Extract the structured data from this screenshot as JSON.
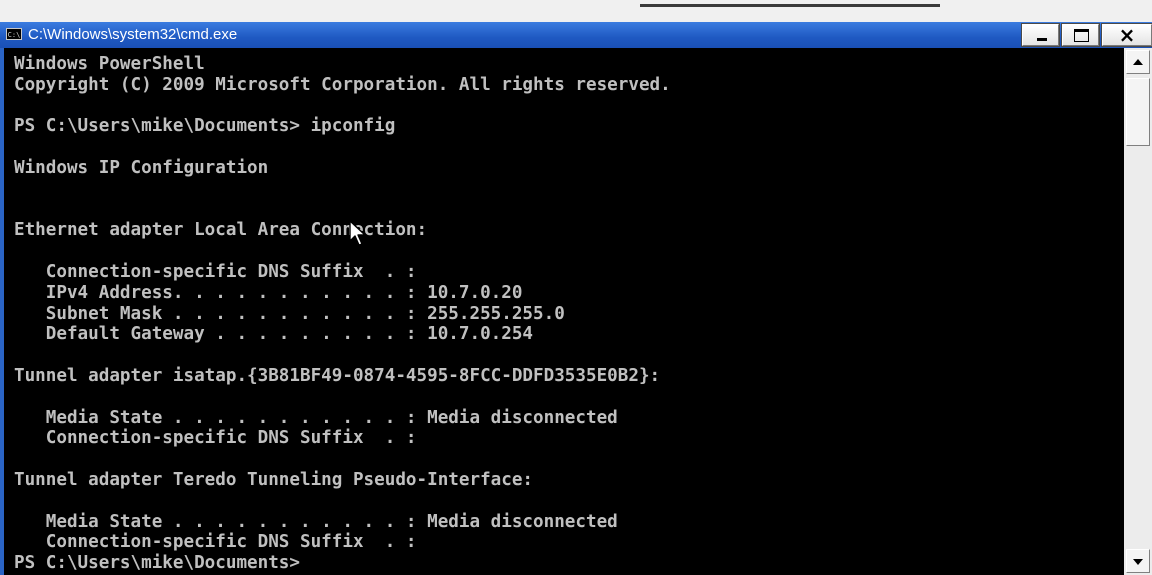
{
  "window": {
    "title": "C:\\Windows\\system32\\cmd.exe",
    "icon_label": "C:\\",
    "icon": "console-icon",
    "buttons": {
      "minimize": "minimize-icon",
      "maximize": "maximize-icon",
      "close_glyph": "×"
    }
  },
  "console": {
    "lines": [
      "Windows PowerShell",
      "Copyright (C) 2009 Microsoft Corporation. All rights reserved.",
      "",
      "PS C:\\Users\\mike\\Documents> ipconfig",
      "",
      "Windows IP Configuration",
      "",
      "",
      "Ethernet adapter Local Area Connection:",
      "",
      "   Connection-specific DNS Suffix  . :",
      "   IPv4 Address. . . . . . . . . . . : 10.7.0.20",
      "   Subnet Mask . . . . . . . . . . . : 255.255.255.0",
      "   Default Gateway . . . . . . . . . : 10.7.0.254",
      "",
      "Tunnel adapter isatap.{3B81BF49-0874-4595-8FCC-DDFD3535E0B2}:",
      "",
      "   Media State . . . . . . . . . . . : Media disconnected",
      "   Connection-specific DNS Suffix  . :",
      "",
      "Tunnel adapter Teredo Tunneling Pseudo-Interface:",
      "",
      "   Media State . . . . . . . . . . . : Media disconnected",
      "   Connection-specific DNS Suffix  . :",
      "PS C:\\Users\\mike\\Documents>"
    ],
    "foreground": "#c0c0c0",
    "background": "#000000"
  },
  "colors": {
    "titlebar": "#1f59c2",
    "console_bg": "#000000",
    "console_text": "#c0c0c0"
  }
}
